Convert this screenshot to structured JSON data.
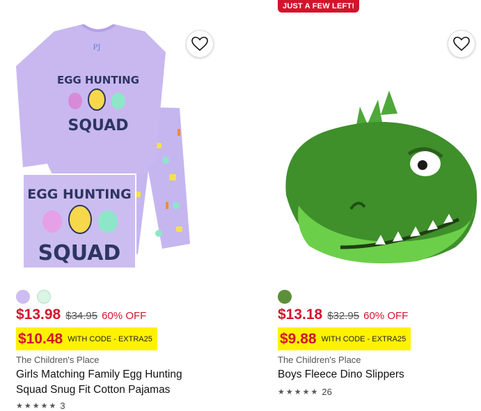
{
  "products": [
    {
      "badge": "",
      "swatches": [
        "#cdbdf0",
        "#d9f5e6"
      ],
      "sale_price": "$13.98",
      "original_price": "$34.95",
      "discount": "60% OFF",
      "code_price": "$10.48",
      "code_text": "WITH CODE - EXTRA25",
      "brand": "The Children's Place",
      "title": "Girls Matching Family Egg Hunting Squad Snug Fit Cotton Pajamas",
      "rating_stars": 5,
      "rating_count": "3",
      "image_text": {
        "shirt_label": "PJ",
        "line1": "EGG HUNTING",
        "line2": "SQUAD"
      }
    },
    {
      "badge": "JUST A FEW LEFT!",
      "swatches": [
        "#5c8f3a"
      ],
      "sale_price": "$13.18",
      "original_price": "$32.95",
      "discount": "60% OFF",
      "code_price": "$9.88",
      "code_text": "WITH CODE - EXTRA25",
      "brand": "The Children's Place",
      "title": "Boys Fleece Dino Slippers",
      "rating_stars": 5,
      "rating_count": "26"
    }
  ],
  "icons": {
    "favorite": "heart-outline-icon",
    "star": "star-icon"
  },
  "colors": {
    "sale_red": "#d2142b",
    "code_highlight": "#fff200"
  }
}
